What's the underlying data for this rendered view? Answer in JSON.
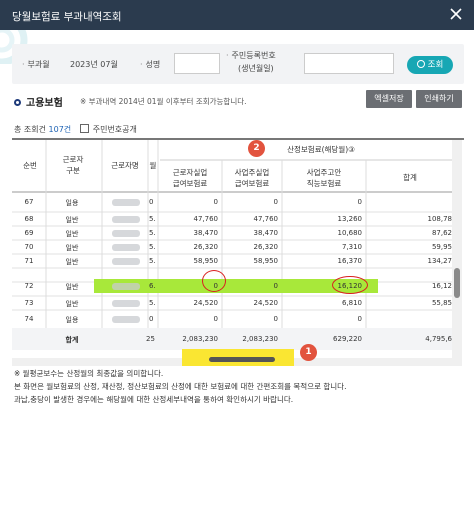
{
  "window": {
    "title": "당월보험료 부과내역조회"
  },
  "search": {
    "period_label": "부과월",
    "period_value": "2023년 07월",
    "name_label": "성명",
    "rrn_label_1": "주민등록번호",
    "rrn_label_2": "(생년월일)",
    "button_label": "조회"
  },
  "section": {
    "title": "고용보험",
    "note": "※ 부과내역 2014년 01월 이후부터 조회가능합니다.",
    "excel_button": "엑셀저장",
    "print_button": "인쇄하기"
  },
  "summary": {
    "count_label": "총 조회건",
    "count_value": "107건",
    "rrn_public_label": "주민번호공개"
  },
  "table": {
    "headers": {
      "seq": "순번",
      "worker_type_1": "근로자",
      "worker_type_2": "구분",
      "worker_name": "근로자명",
      "month": "월",
      "group": "산정보험료(해당월)③",
      "col1_1": "근로자실업",
      "col1_2": "급여보험료",
      "col2_1": "사업주실업",
      "col2_2": "급여보험료",
      "col3_1": "사업주고안",
      "col3_2": "직능보험료",
      "total": "합계"
    },
    "rows": [
      {
        "seq": "67",
        "type": "일용",
        "month": "0",
        "c1": "0",
        "c2": "0",
        "c3": "0",
        "total": ""
      },
      {
        "seq": "68",
        "type": "일반",
        "month": "5.",
        "c1": "47,760",
        "c2": "47,760",
        "c3": "13,260",
        "total": "108,78"
      },
      {
        "seq": "69",
        "type": "일반",
        "month": "5.",
        "c1": "38,470",
        "c2": "38,470",
        "c3": "10,680",
        "total": "87,62"
      },
      {
        "seq": "70",
        "type": "일반",
        "month": "5.",
        "c1": "26,320",
        "c2": "26,320",
        "c3": "7,310",
        "total": "59,95"
      },
      {
        "seq": "71",
        "type": "일반",
        "month": "5.",
        "c1": "58,950",
        "c2": "58,950",
        "c3": "16,370",
        "total": "134,27"
      },
      {
        "seq": "72",
        "type": "일반",
        "month": "6.",
        "c1": "0",
        "c2": "0",
        "c3": "16,120",
        "total": "16,12"
      },
      {
        "seq": "73",
        "type": "일반",
        "month": "5.",
        "c1": "24,520",
        "c2": "24,520",
        "c3": "6,810",
        "total": "55,85"
      },
      {
        "seq": "74",
        "type": "일용",
        "month": "0",
        "c1": "0",
        "c2": "0",
        "c3": "0",
        "total": ""
      }
    ],
    "totals": {
      "label": "합계",
      "month": "25",
      "c1": "2,083,230",
      "c2": "2,083,230",
      "c3": "629,220",
      "total": "4,795,6"
    }
  },
  "badges": {
    "one": "1",
    "two": "2"
  },
  "footnotes": {
    "line1": "※ 월평균보수는 산정월의 최종값을 의미합니다.",
    "line2": "본 화면은 월보험료의 산정, 재산정, 정산보험료의 산정에 대한 보험료에 대한 간편조회를 목적으로 합니다.",
    "line3": "과납,충당이 발생한 경우에는 해당월에 대한 산정세부내역을 통하여 확인하시기 바랍니다."
  },
  "colors": {
    "titlebar": "#2b3b4e",
    "accent": "#17a7b4",
    "highlight_green": "#a8e83a",
    "highlight_yellow": "#fae632",
    "badge_red": "#e2533e",
    "annotation_red": "#d92020"
  }
}
